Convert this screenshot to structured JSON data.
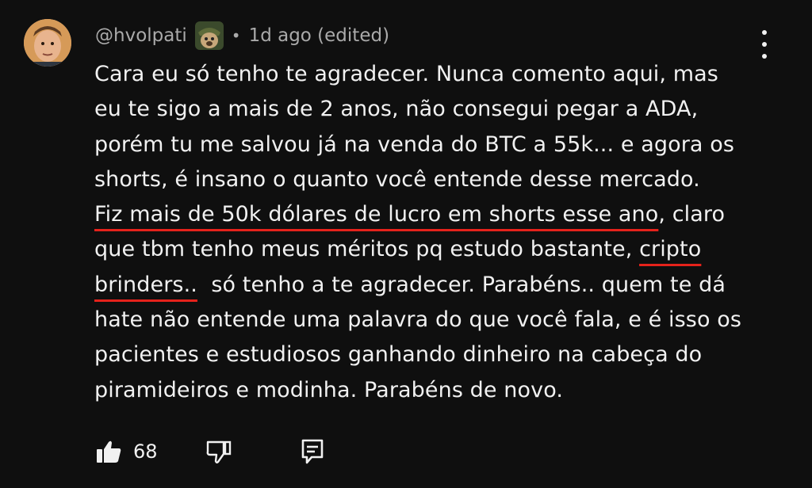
{
  "comment": {
    "author": "@hvolpati",
    "separator": "•",
    "timestamp": "1d ago (edited)",
    "lines": [
      "Cara eu só tenho te agradecer. Nunca comento aqui, mas",
      "eu te sigo a mais de 2 anos, não consegui pegar a ADA,",
      "porém tu me salvou já na venda do BTC a 55k... e agora os",
      "shorts, é insano  o quanto você entende desse mercado.",
      "claro",
      "que tbm tenho meus méritos pq estudo bastante,",
      "só tenho a te agradecer. Parabéns.. quem te dá",
      "hate  não entende uma palavra do que você fala, e é isso os",
      "pacientes e estudiosos ganhando dinheiro na cabeça do",
      "piramideiros e modinha. Parabéns de novo."
    ],
    "highlight_1": "Fiz mais de 50k dólares de lucro em shorts esse ano",
    "highlight_1_suffix": ", ",
    "highlight_2a": "cripto",
    "highlight_2b": "brinders..",
    "highlight_color": "#e5221b"
  },
  "actions": {
    "like_count": "68",
    "like_icon": "thumbs-up-icon",
    "dislike_icon": "thumbs-down-icon",
    "reply_icon": "reply-comment-icon"
  }
}
